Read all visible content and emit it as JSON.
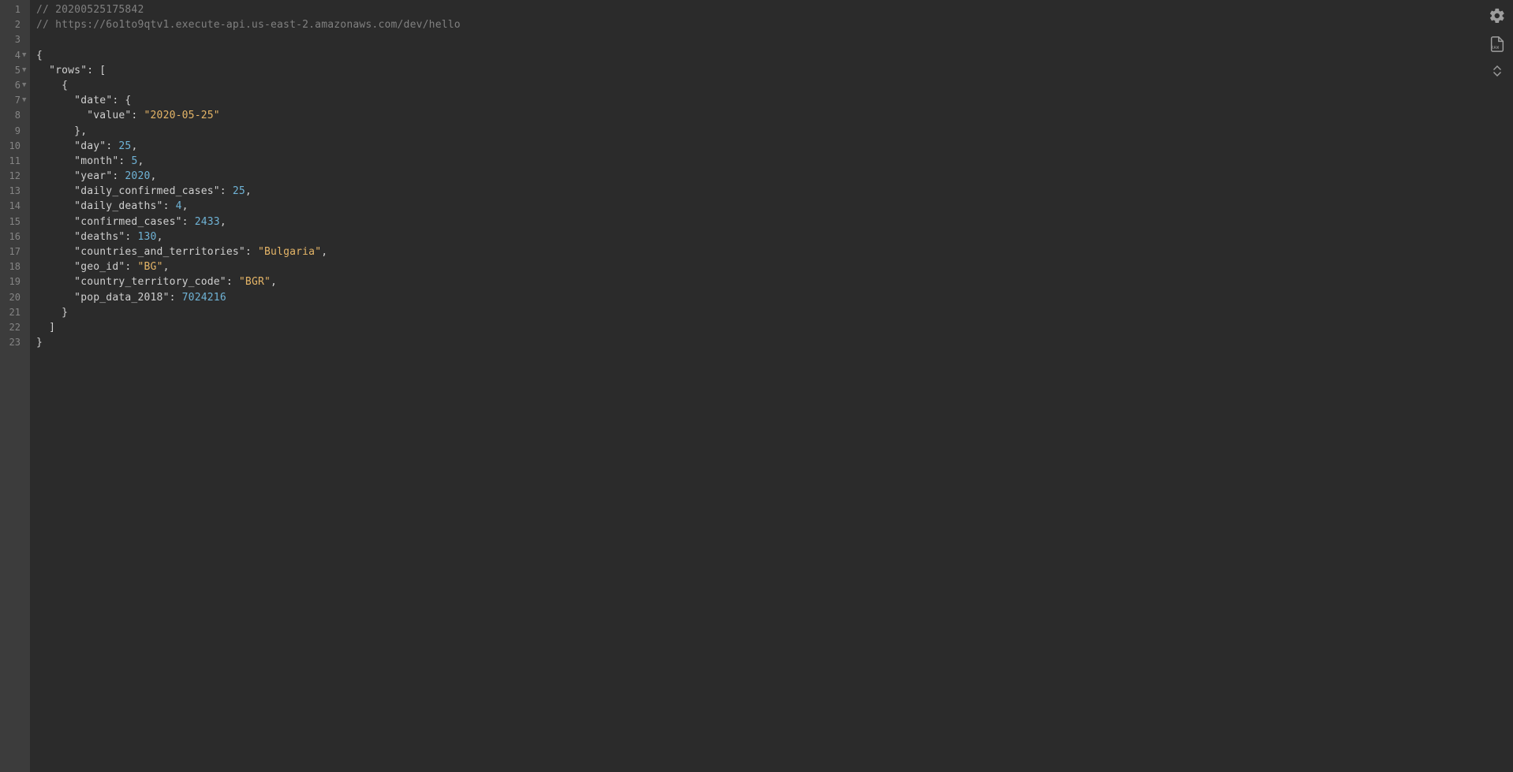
{
  "comments": {
    "timestamp": "20200525175842",
    "source_url": "https://6o1to9qtv1.execute-api.us-east-2.amazonaws.com/dev/hello"
  },
  "json_body": {
    "rows_key": "rows",
    "date_key": "date",
    "value_key": "value",
    "date_value": "2020-05-25",
    "day_key": "day",
    "day_value": "25",
    "month_key": "month",
    "month_value": "5",
    "year_key": "year",
    "year_value": "2020",
    "dcc_key": "daily_confirmed_cases",
    "dcc_value": "25",
    "dd_key": "daily_deaths",
    "dd_value": "4",
    "cc_key": "confirmed_cases",
    "cc_value": "2433",
    "deaths_key": "deaths",
    "deaths_value": "130",
    "cat_key": "countries_and_territories",
    "cat_value": "Bulgaria",
    "geo_key": "geo_id",
    "geo_value": "BG",
    "ctc_key": "country_territory_code",
    "ctc_value": "BGR",
    "pop_key": "pop_data_2018",
    "pop_value": "7024216"
  },
  "line_numbers": [
    "1",
    "2",
    "3",
    "4",
    "5",
    "6",
    "7",
    "8",
    "9",
    "10",
    "11",
    "12",
    "13",
    "14",
    "15",
    "16",
    "17",
    "18",
    "19",
    "20",
    "21",
    "22",
    "23"
  ],
  "fold_lines": [
    4,
    5,
    6,
    7
  ],
  "tools": {
    "settings_label": "settings",
    "raw_label": "RAW",
    "up_label": "collapse",
    "down_label": "expand"
  }
}
